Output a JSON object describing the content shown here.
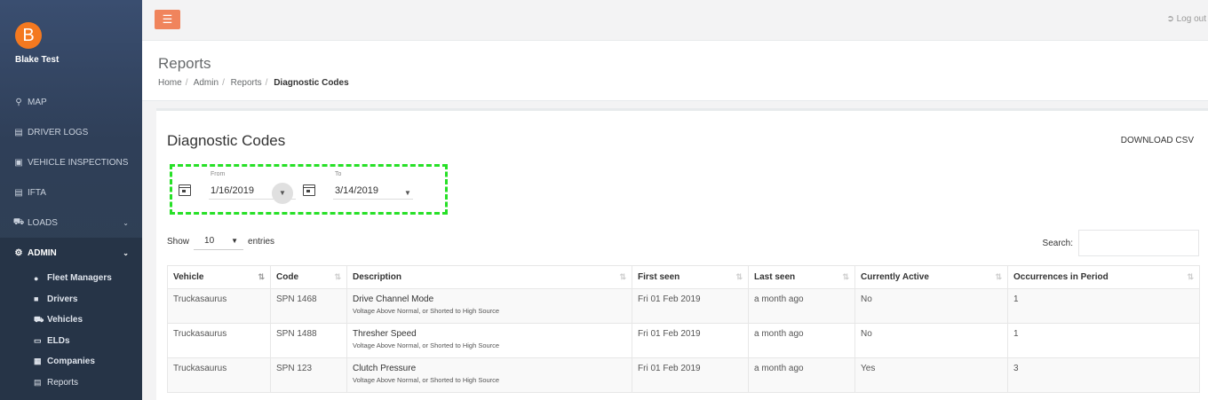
{
  "user": {
    "initial": "B",
    "name": "Blake Test"
  },
  "nav": [
    {
      "label": "MAP",
      "icon": "map-pin-icon"
    },
    {
      "label": "DRIVER LOGS",
      "icon": "document-icon"
    },
    {
      "label": "VEHICLE INSPECTIONS",
      "icon": "clipboard-icon"
    },
    {
      "label": "IFTA",
      "icon": "file-icon"
    },
    {
      "label": "LOADS",
      "icon": "truck-icon"
    }
  ],
  "admin": {
    "label": "ADMIN",
    "items": [
      {
        "label": "Fleet Managers",
        "icon": "users-icon"
      },
      {
        "label": "Drivers",
        "icon": "id-card-icon"
      },
      {
        "label": "Vehicles",
        "icon": "truck-icon"
      },
      {
        "label": "ELDs",
        "icon": "laptop-icon"
      },
      {
        "label": "Companies",
        "icon": "building-icon"
      },
      {
        "label": "Reports",
        "icon": "chart-icon"
      }
    ]
  },
  "topbar": {
    "logout": "Log out"
  },
  "header": {
    "title": "Reports",
    "breadcrumb": [
      "Home",
      "Admin",
      "Reports",
      "Diagnostic Codes"
    ]
  },
  "panel": {
    "title": "Diagnostic Codes",
    "download": "DOWNLOAD CSV",
    "from_label": "From",
    "from_value": "1/16/2019",
    "to_label": "To",
    "to_value": "3/14/2019",
    "show_label": "Show",
    "entries_value": "10",
    "entries_label": "entries",
    "search_label": "Search:"
  },
  "table": {
    "columns": [
      "Vehicle",
      "Code",
      "Description",
      "First seen",
      "Last seen",
      "Currently Active",
      "Occurrences in Period"
    ],
    "rows": [
      {
        "vehicle": "Truckasaurus",
        "code": "SPN 1468",
        "desc": "Drive Channel Mode",
        "detail": "Voltage Above Normal, or Shorted to High Source",
        "first": "Fri 01 Feb 2019",
        "last": "a month ago",
        "active": "No",
        "occ": "1"
      },
      {
        "vehicle": "Truckasaurus",
        "code": "SPN 1488",
        "desc": "Thresher Speed",
        "detail": "Voltage Above Normal, or Shorted to High Source",
        "first": "Fri 01 Feb 2019",
        "last": "a month ago",
        "active": "No",
        "occ": "1"
      },
      {
        "vehicle": "Truckasaurus",
        "code": "SPN 123",
        "desc": "Clutch Pressure",
        "detail": "Voltage Above Normal, or Shorted to High Source",
        "first": "Fri 01 Feb 2019",
        "last": "a month ago",
        "active": "Yes",
        "occ": "3"
      }
    ]
  },
  "colors": {
    "accent": "#f0845c",
    "avatar": "#f47920",
    "highlight": "#27e027",
    "sidebar": "#2f4050"
  }
}
